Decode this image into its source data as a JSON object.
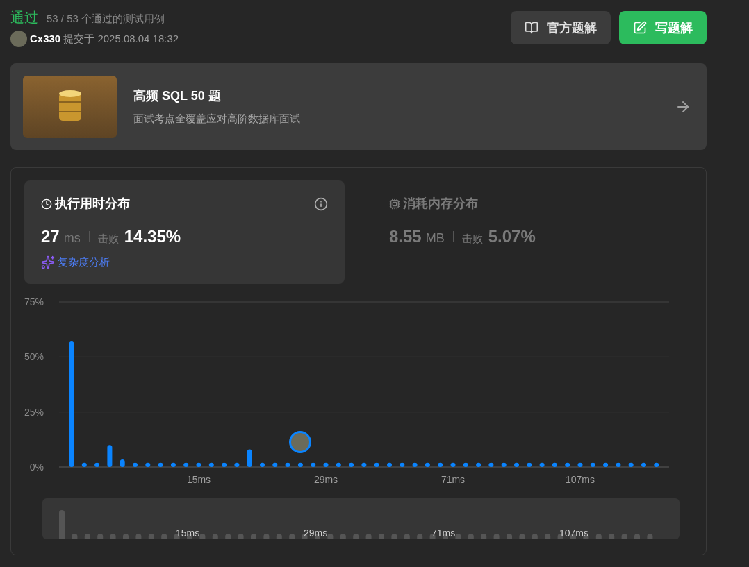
{
  "result": {
    "status": "通过",
    "count": "53 / 53",
    "count_label": "个通过的测试用例"
  },
  "submission": {
    "user": "Cx330",
    "label": "提交于",
    "time": "2025.08.04 18:32"
  },
  "actions": [
    {
      "kind": "book",
      "label": "官方题解"
    },
    {
      "kind": "edit",
      "label": "写题解"
    }
  ],
  "study_plan": {
    "title": "高频 SQL 50 题",
    "subtitle": "面试考点全覆盖应对高阶数据库面试"
  },
  "tabs": [
    {
      "kind": "clock",
      "title": "执行用时分布",
      "value": "27",
      "unit": "ms",
      "beat_label": "击败",
      "beat": "14.35%",
      "info": true,
      "link": "复杂度分析",
      "selected": true
    },
    {
      "kind": "chip",
      "title": "消耗内存分布",
      "value": "8.55",
      "unit": "MB",
      "beat_label": "击败",
      "beat": "5.07%",
      "info": false,
      "selected": false
    }
  ],
  "chart_data": {
    "type": "bar",
    "yticks": [
      {
        "value": 0,
        "label": "0%"
      },
      {
        "value": 25,
        "label": "25%"
      },
      {
        "value": 50,
        "label": "50%"
      },
      {
        "value": 75,
        "label": "75%"
      }
    ],
    "ylim": [
      0,
      75
    ],
    "categories": [
      null,
      null,
      null,
      null,
      null,
      null,
      null,
      null,
      null,
      null,
      "15ms",
      null,
      null,
      null,
      null,
      null,
      null,
      null,
      null,
      null,
      "29ms",
      null,
      null,
      null,
      null,
      null,
      null,
      null,
      null,
      null,
      "71ms",
      null,
      null,
      null,
      null,
      null,
      null,
      null,
      null,
      null,
      "107ms",
      null,
      null,
      null,
      null,
      null,
      null
    ],
    "series": [
      {
        "color": "#0a84ff",
        "values": [
          57,
          2,
          2,
          10,
          3.5,
          2,
          2,
          2,
          2,
          2,
          2,
          2,
          2,
          2,
          8,
          2,
          2,
          2,
          2,
          2,
          2,
          2,
          2,
          2,
          2,
          2,
          2,
          2,
          2,
          2,
          2,
          2,
          2,
          2,
          2,
          2,
          2,
          2,
          2,
          2,
          2,
          2,
          2,
          2,
          2,
          2,
          2
        ]
      }
    ]
  },
  "overview_labels": [
    "15ms",
    "29ms",
    "71ms",
    "107ms"
  ]
}
